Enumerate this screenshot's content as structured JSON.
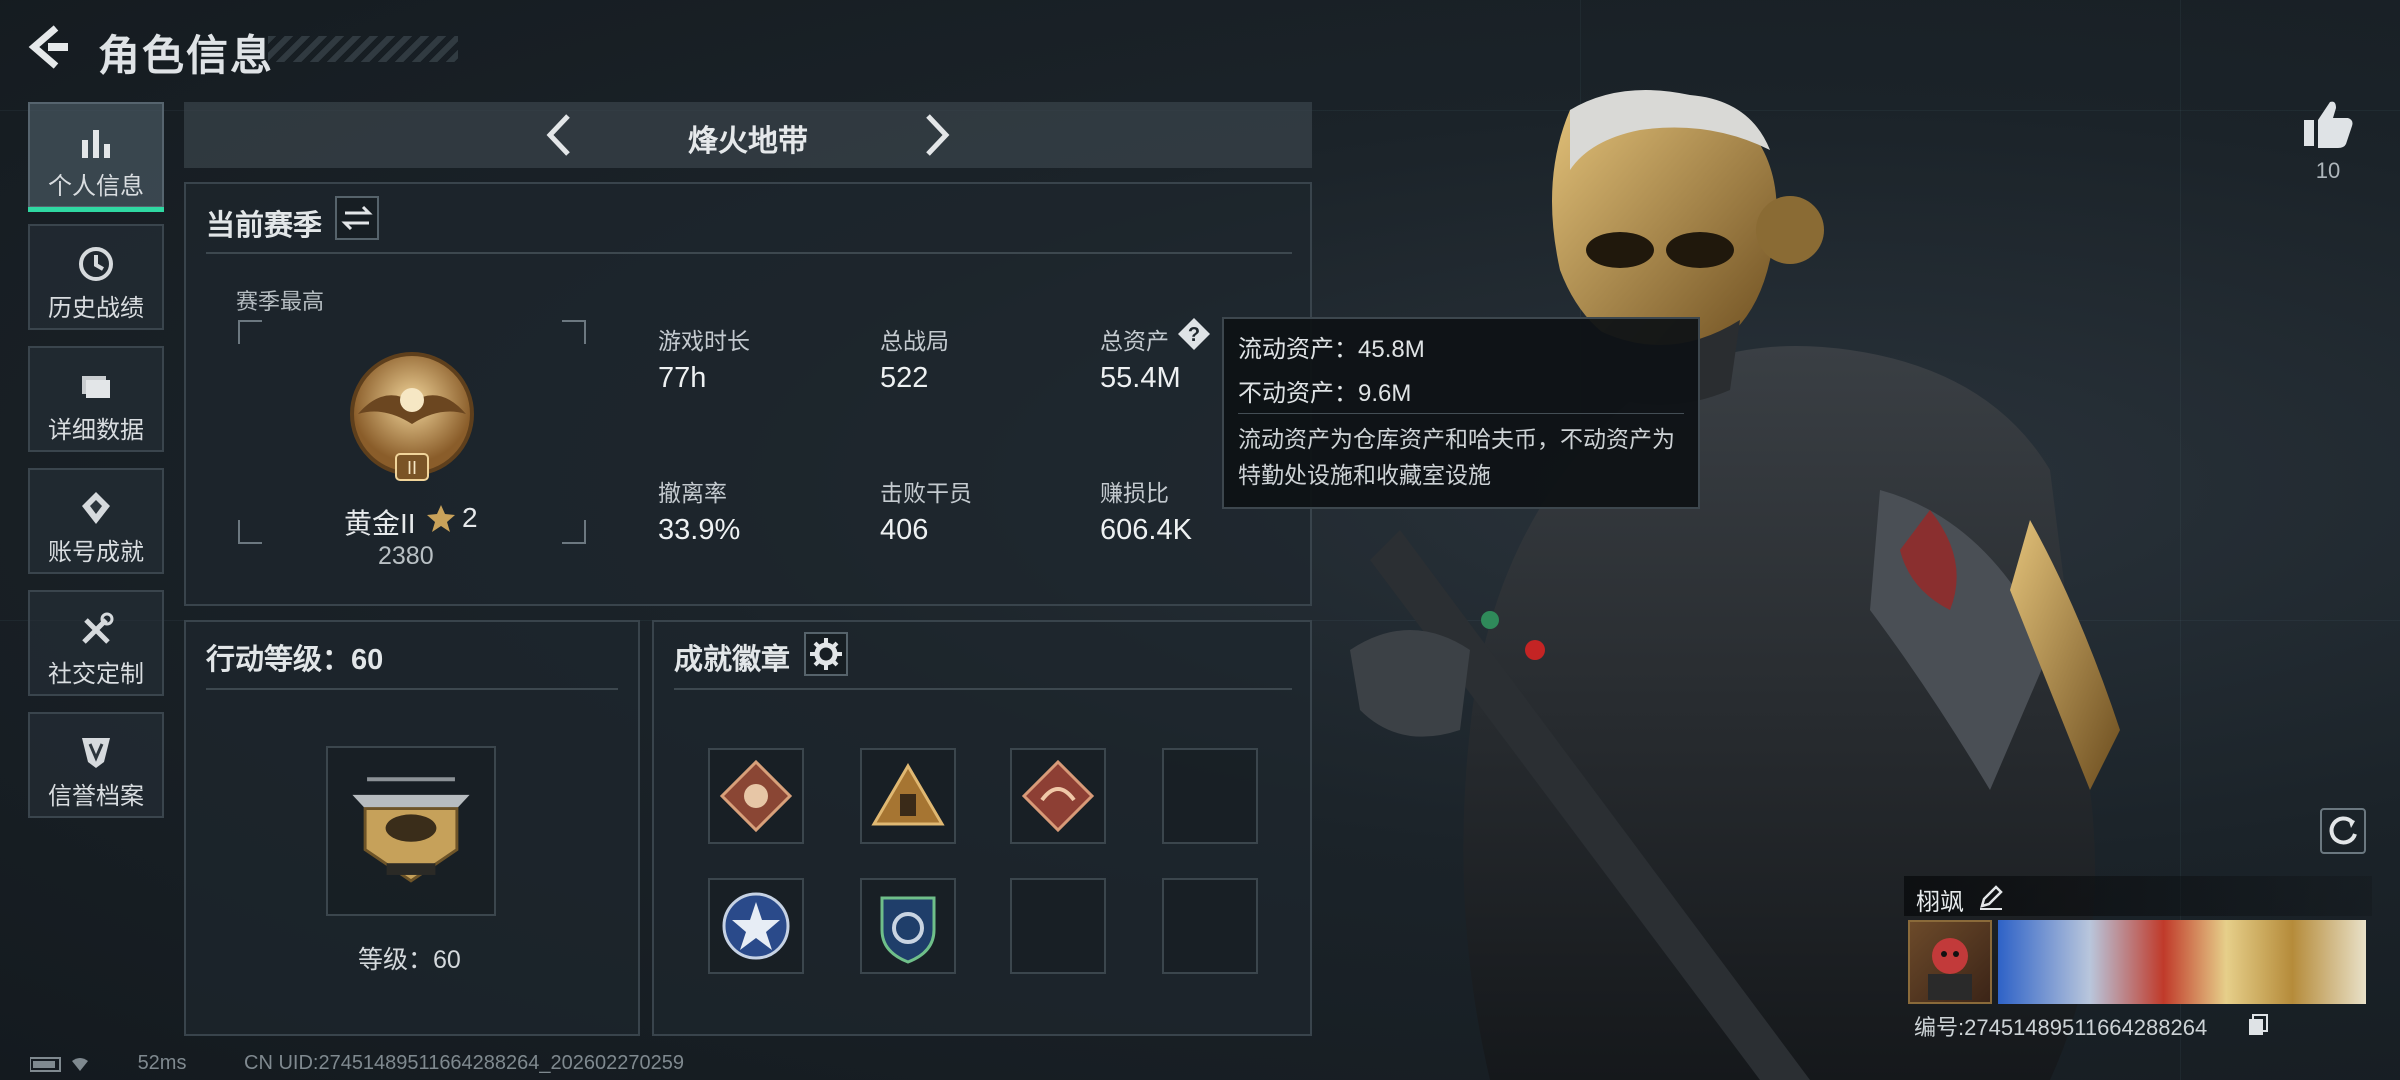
{
  "header": {
    "title": "角色信息"
  },
  "nav": {
    "items": [
      {
        "label": "个人信息",
        "icon": "bar-chart-icon"
      },
      {
        "label": "历史战绩",
        "icon": "clock-icon"
      },
      {
        "label": "详细数据",
        "icon": "folder-icon"
      },
      {
        "label": "账号成就",
        "icon": "achievement-icon"
      },
      {
        "label": "社交定制",
        "icon": "tools-icon"
      },
      {
        "label": "信誉档案",
        "icon": "shield-icon"
      }
    ]
  },
  "mode": {
    "title": "烽火地带"
  },
  "season": {
    "title": "当前赛季",
    "best_label": "赛季最高",
    "rank_name": "黄金II",
    "rank_stars": "2",
    "rank_score": "2380",
    "stats": [
      {
        "label": "游戏时长",
        "value": "77h"
      },
      {
        "label": "总战局",
        "value": "522"
      },
      {
        "label": "总资产",
        "value": "55.4M"
      },
      {
        "label": "撤离率",
        "value": "33.9%"
      },
      {
        "label": "击败干员",
        "value": "406"
      },
      {
        "label": "赚损比",
        "value": "606.4K"
      }
    ]
  },
  "tooltip": {
    "liquid": "流动资产：45.8M",
    "fixed": "不动资产：9.6M",
    "desc": "流动资产为仓库资产和哈夫币，不动资产为特勤处设施和收藏室设施"
  },
  "level": {
    "title": "行动等级：60",
    "label": "等级：60"
  },
  "badges": {
    "title": "成就徽章"
  },
  "profile": {
    "likes": "10",
    "name": "栩飒",
    "id_text": "编号:27451489511664288264"
  },
  "status": {
    "ping": "52ms",
    "uid": "CN UID:27451489511664288264_202602270259"
  },
  "colors": {
    "accent": "#2fd8a2",
    "gold": "#c9a25a"
  }
}
